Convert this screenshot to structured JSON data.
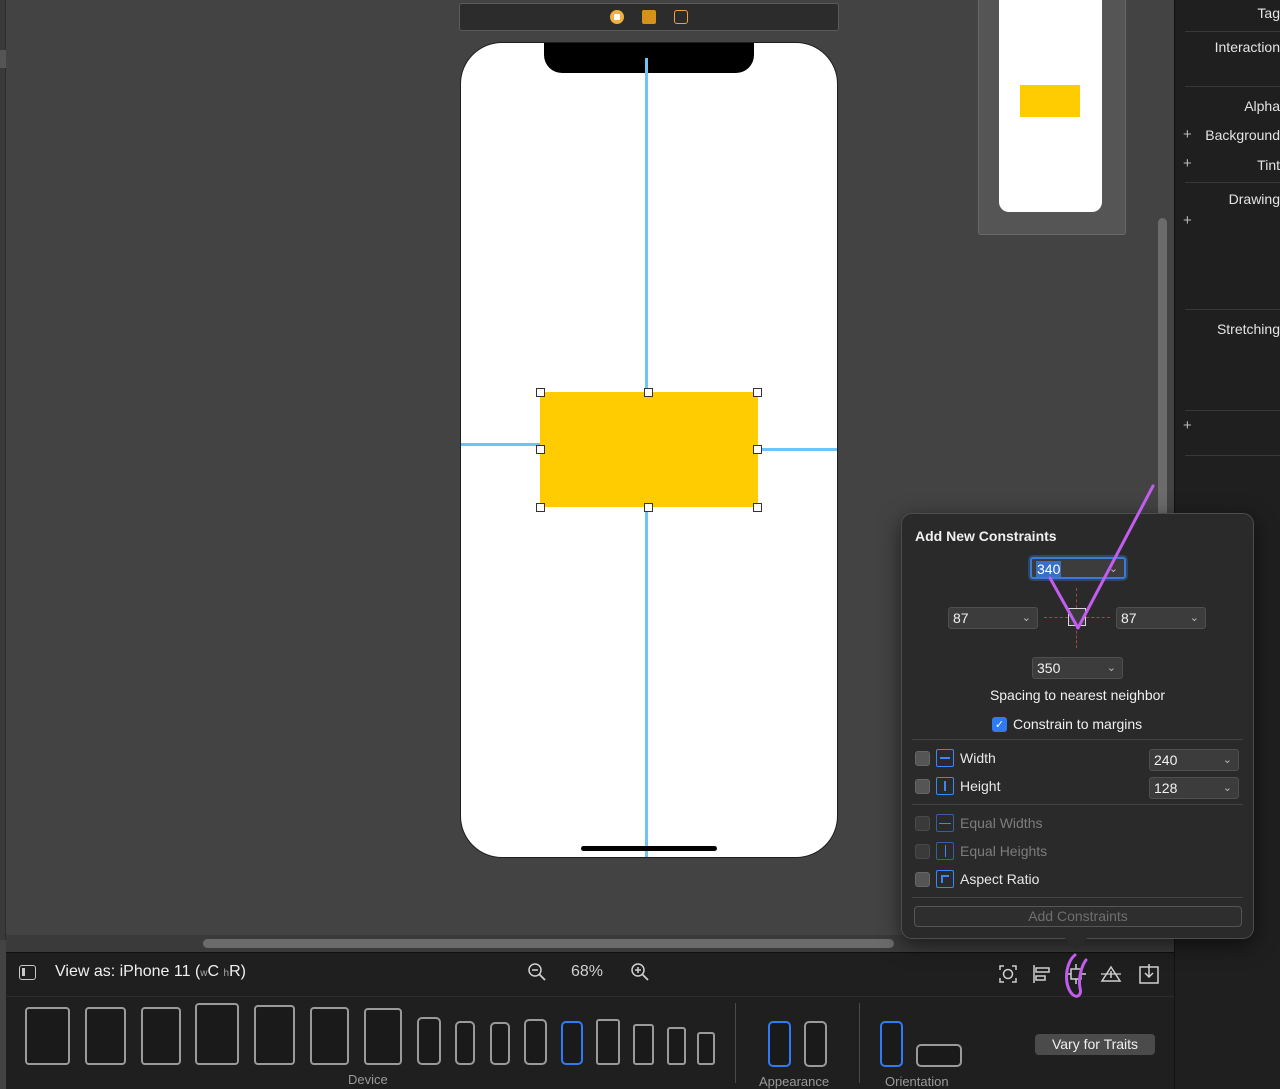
{
  "inspector": {
    "tag_label": "Tag",
    "interaction_label": "Interaction",
    "alpha_label": "Alpha",
    "background_label": "Background",
    "tint_label": "Tint",
    "drawing_label": "Drawing",
    "stretching_label": "Stretching"
  },
  "constraints_popover": {
    "title": "Add New Constraints",
    "top_value": "340",
    "leading_value": "87",
    "trailing_value": "87",
    "bottom_value": "350",
    "spacing_label": "Spacing to nearest neighbor",
    "constrain_to_margins": "Constrain to margins",
    "width_label": "Width",
    "width_value": "240",
    "height_label": "Height",
    "height_value": "128",
    "equal_widths": "Equal Widths",
    "equal_heights": "Equal Heights",
    "aspect_ratio": "Aspect Ratio",
    "add_button": "Add Constraints"
  },
  "bottom_bar": {
    "view_as_prefix": "View as: iPhone 11 (",
    "size_w": "w",
    "size_w_class": "C",
    "size_h": "h",
    "size_h_class": "R",
    "view_as_suffix": ")",
    "zoom": "68%"
  },
  "device_tray": {
    "device_label": "Device",
    "appearance_label": "Appearance",
    "orientation_label": "Orientation",
    "vary_button": "Vary for Traits"
  },
  "colors": {
    "canvas": "#434343",
    "yellow_view": "#fecc00",
    "guide": "#6ec5f5",
    "accent": "#2f7bf5",
    "annotation": "#c35df0"
  }
}
